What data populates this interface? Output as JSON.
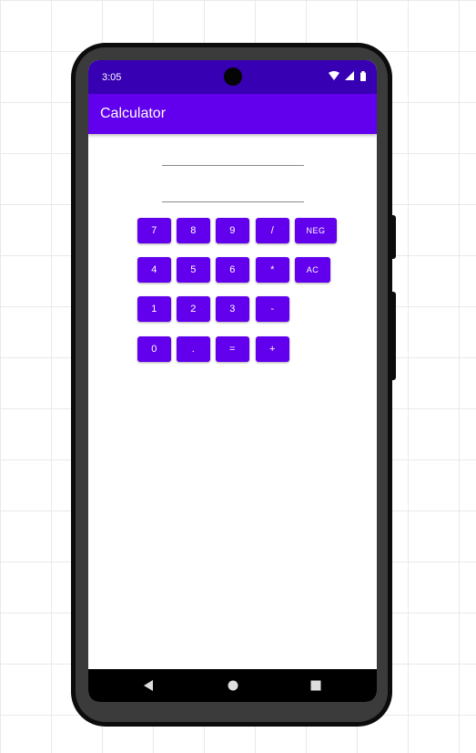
{
  "status_bar": {
    "time": "3:05",
    "icons": [
      "wifi-icon",
      "signal-icon",
      "battery-icon"
    ]
  },
  "app_bar": {
    "title": "Calculator",
    "color": "#6200ee",
    "status_color": "#3700b3"
  },
  "inputs": {
    "first_value": "",
    "second_value": ""
  },
  "keypad": {
    "rows": [
      [
        "7",
        "8",
        "9",
        "/",
        "NEG"
      ],
      [
        "4",
        "5",
        "6",
        "*",
        "AC"
      ],
      [
        "1",
        "2",
        "3",
        "-"
      ],
      [
        "0",
        ".",
        "=",
        "+"
      ]
    ],
    "key_color": "#6200ee"
  },
  "nav_bar": {
    "icons": [
      "back-icon",
      "home-icon",
      "recents-icon"
    ]
  }
}
